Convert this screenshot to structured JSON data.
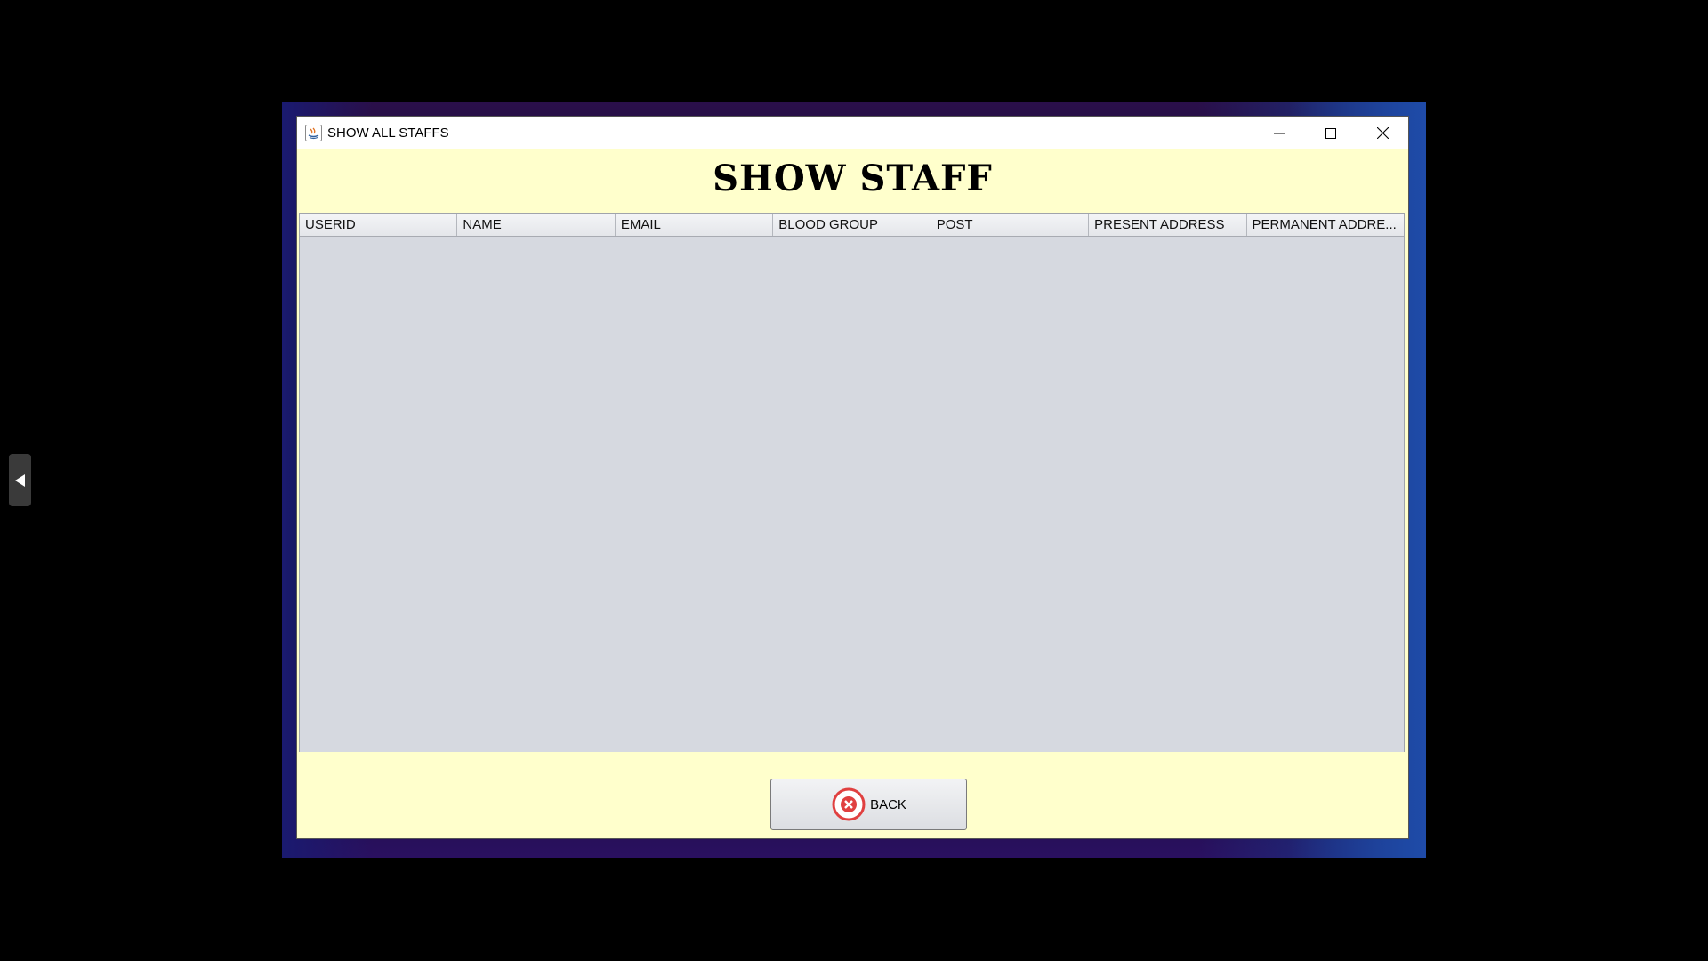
{
  "window": {
    "title": "SHOW ALL STAFFS",
    "controls": [
      "minimize-icon",
      "maximize-icon",
      "close-icon"
    ]
  },
  "page": {
    "heading": "SHOW STAFF"
  },
  "table": {
    "columns": [
      "USERID",
      "NAME",
      "EMAIL",
      "BLOOD GROUP",
      "POST",
      "PRESENT ADDRESS",
      "PERMANENT ADDRE..."
    ],
    "rows": []
  },
  "footer": {
    "back_label": "BACK"
  },
  "colors": {
    "panel_background": "#ffffcc",
    "table_background": "#d6d9e0",
    "back_icon": "#e04040"
  }
}
